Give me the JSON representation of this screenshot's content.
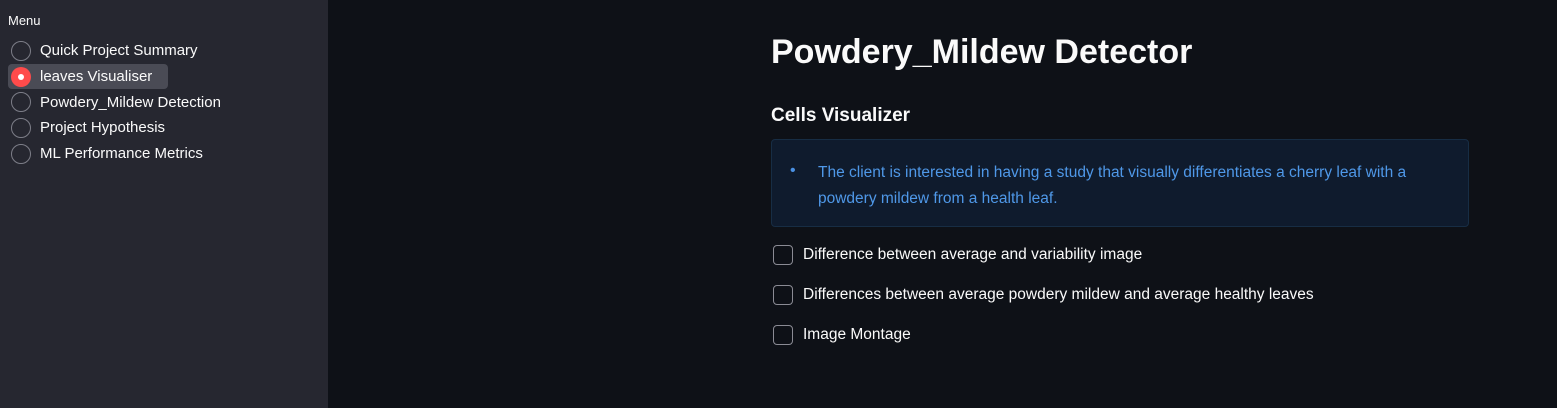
{
  "sidebar": {
    "menu_title": "Menu",
    "items": [
      {
        "label": "Quick Project Summary",
        "selected": false
      },
      {
        "label": "leaves Visualiser",
        "selected": true
      },
      {
        "label": "Powdery_Mildew Detection",
        "selected": false
      },
      {
        "label": "Project Hypothesis",
        "selected": false
      },
      {
        "label": "ML Performance Metrics",
        "selected": false
      }
    ]
  },
  "main": {
    "title": "Powdery_Mildew Detector",
    "subheader": "Cells Visualizer",
    "info": {
      "bullet": "•",
      "text": "The client is interested in having a study that visually differentiates a cherry leaf with a powdery mildew from a health leaf."
    },
    "checkboxes": [
      {
        "label": "Difference between average and variability image",
        "checked": false
      },
      {
        "label": "Differences between average powdery mildew and average healthy leaves",
        "checked": false
      },
      {
        "label": "Image Montage",
        "checked": false
      }
    ]
  },
  "colors": {
    "background": "#0e1117",
    "sidebar": "#262730",
    "accent": "#ff4b4b",
    "info_text": "#4f98e8",
    "info_bg": "#0f1b2d"
  }
}
